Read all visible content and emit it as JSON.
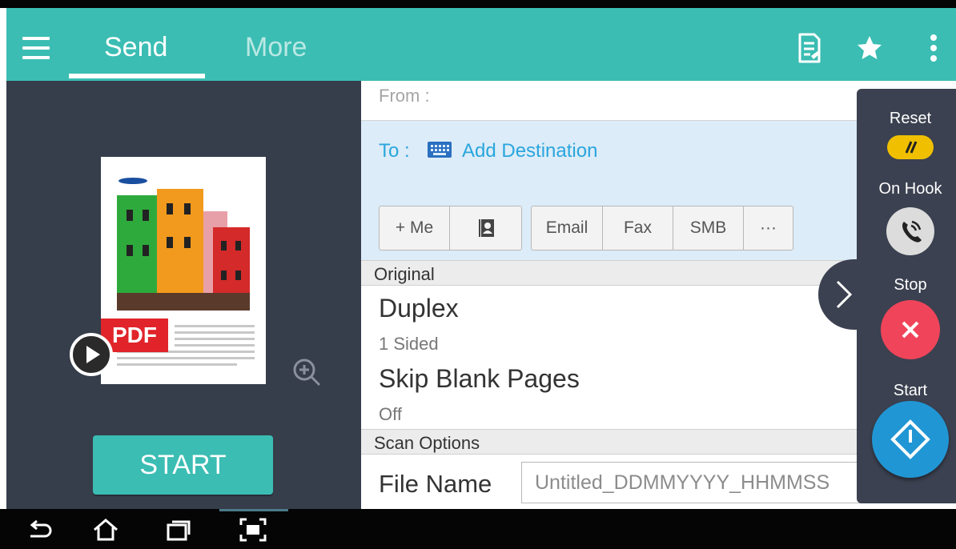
{
  "header": {
    "tabs": [
      {
        "label": "Send",
        "active": true
      },
      {
        "label": "More",
        "active": false
      }
    ],
    "icons": [
      "menu-icon",
      "document-list-icon",
      "star-icon",
      "more-vertical-icon"
    ],
    "accent_color": "#3bbdb3"
  },
  "preview": {
    "badge": "PDF",
    "start_label": "START"
  },
  "form": {
    "from_label": "From :",
    "to_label": "To :",
    "add_destination": "Add Destination",
    "destination_buttons": [
      "+ Me",
      "Email",
      "Fax",
      "SMB",
      "···"
    ],
    "original_section": "Original",
    "duplex_title": "Duplex",
    "duplex_value": "1 Sided",
    "skip_title": "Skip Blank Pages",
    "skip_value": "Off",
    "scan_section": "Scan Options",
    "file_name_label": "File Name",
    "file_name_value": "Untitled_DDMMYYYY_HHMMSS"
  },
  "side_panel": {
    "reset_label": "Reset",
    "on_hook_label": "On Hook",
    "stop_label": "Stop",
    "start_label": "Start",
    "colors": {
      "reset": "#f0c000",
      "stop": "#f0445a",
      "start": "#2196d4"
    }
  },
  "navbar": {
    "icons": [
      "back-icon",
      "home-icon",
      "recent-apps-icon",
      "screen-capture-icon"
    ]
  }
}
